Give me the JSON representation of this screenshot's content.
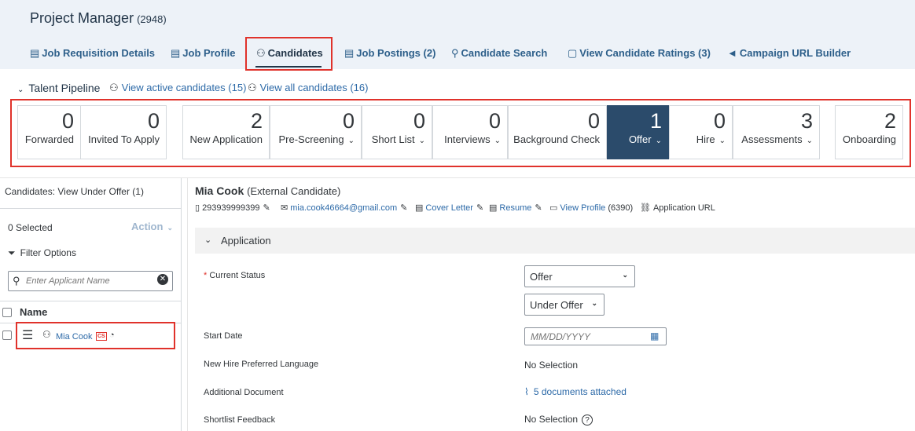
{
  "page": {
    "title": "Project Manager",
    "count": "(2948)"
  },
  "tabs": [
    {
      "label": "Job Requisition Details",
      "icon": "document-icon",
      "glyph": "▤"
    },
    {
      "label": "Job Profile",
      "icon": "profile-doc-icon",
      "glyph": "▤"
    },
    {
      "label": "Candidates",
      "icon": "people-icon",
      "glyph": "⚇"
    },
    {
      "label": "Job Postings (2)",
      "icon": "postings-icon",
      "glyph": "▤"
    },
    {
      "label": "Candidate Search",
      "icon": "search-icon",
      "glyph": "⚲"
    },
    {
      "label": "View Candidate Ratings (3)",
      "icon": "clipboard-icon",
      "glyph": "▢"
    },
    {
      "label": "Campaign URL Builder",
      "icon": "megaphone-icon",
      "glyph": "◄"
    }
  ],
  "pipeline": {
    "title": "Talent Pipeline",
    "active_link": "View active candidates (15)",
    "all_link": "View all candidates (16)",
    "stages": [
      {
        "count": "0",
        "label": "Forwarded",
        "dropdown": false
      },
      {
        "count": "0",
        "label": "Invited To Apply",
        "dropdown": false
      },
      {
        "count": "2",
        "label": "New Application",
        "dropdown": false
      },
      {
        "count": "0",
        "label": "Pre-Screening",
        "dropdown": true
      },
      {
        "count": "0",
        "label": "Short List",
        "dropdown": true
      },
      {
        "count": "0",
        "label": "Interviews",
        "dropdown": true
      },
      {
        "count": "0",
        "label": "Background Check",
        "dropdown": false
      },
      {
        "count": "1",
        "label": "Offer",
        "dropdown": true,
        "selected": true
      },
      {
        "count": "0",
        "label": "Hire",
        "dropdown": true
      },
      {
        "count": "3",
        "label": "Assessments",
        "dropdown": true
      },
      {
        "count": "2",
        "label": "Onboarding",
        "dropdown": false
      }
    ]
  },
  "left": {
    "view_title": "Candidates: View Under Offer (1)",
    "selected": "0 Selected",
    "action": "Action",
    "filter": "Filter Options",
    "search_placeholder": "Enter Applicant Name",
    "col_name": "Name",
    "candidate": "Mia Cook",
    "badge": "CS"
  },
  "candidate": {
    "name": "Mia Cook",
    "type": "(External Candidate)",
    "phone": "293939999399",
    "email": "mia.cook46664@gmail.com",
    "cover_letter": "Cover Letter",
    "resume": "Resume",
    "view_profile": "View Profile",
    "profile_count": "(6390)",
    "application_url": "Application URL"
  },
  "application": {
    "section": "Application",
    "current_status_label": "Current Status",
    "required_mark": "*",
    "status_value": "Offer",
    "substatus_value": "Under Offer",
    "start_date_label": "Start Date",
    "start_date_placeholder": "MM/DD/YYYY",
    "language_label": "New Hire Preferred Language",
    "language_value": "No Selection",
    "additional_doc_label": "Additional Document",
    "additional_doc_value": "5 documents attached",
    "shortlist_label": "Shortlist Feedback",
    "shortlist_value": "No Selection"
  },
  "colors": {
    "accent": "#2b4b6b",
    "link": "#2d6aa8",
    "highlight": "#e0322b"
  }
}
